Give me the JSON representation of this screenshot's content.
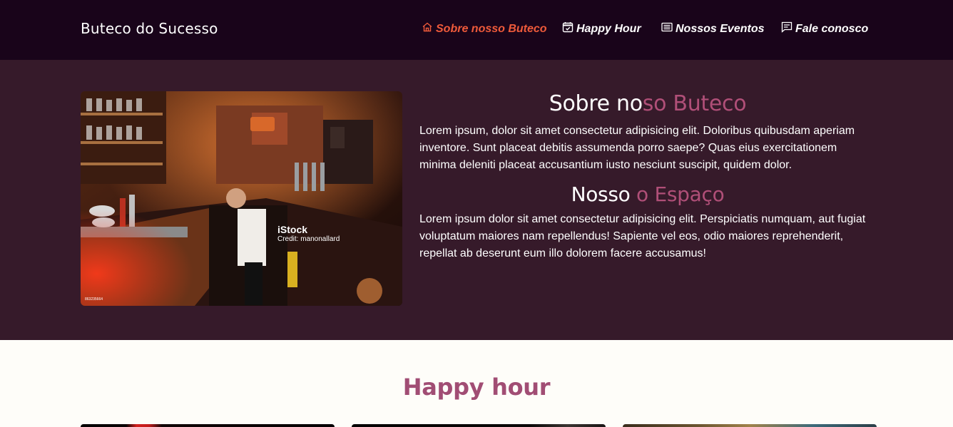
{
  "navbar": {
    "brand": "Buteco do Sucesso",
    "items": [
      {
        "label": "Sobre nosso Buteco",
        "icon": "home-icon",
        "active": true
      },
      {
        "label": "Happy Hour",
        "icon": "calendar-check-icon",
        "active": false
      },
      {
        "label": "Nossos Eventos",
        "icon": "newspaper-icon",
        "active": false
      },
      {
        "label": "Fale conosco",
        "icon": "chat-icon",
        "active": false
      }
    ],
    "colors": {
      "background": "#19041a",
      "active": "#ee5a3a",
      "text": "#ffffff"
    }
  },
  "about": {
    "image": {
      "description": "bar-interior-photo",
      "watermark_brand": "iStock",
      "watermark_credit": "Credit: manonallard",
      "watermark_id": "863235664"
    },
    "heading1_white": "Sobre no",
    "heading1_pink": "so Buteco",
    "paragraph1": "Lorem ipsum, dolor sit amet consectetur adipisicing elit. Doloribus quibusdam aperiam inventore. Sunt placeat debitis assumenda porro saepe? Quas eius exercitationem minima deleniti placeat accusantium iusto nesciunt suscipit, quidem dolor.",
    "heading2_white": "Nosso ",
    "heading2_pink": "o Espaço",
    "paragraph2": "Lorem ipsum dolor sit amet consectetur adipisicing elit. Perspiciatis numquam, aut fugiat voluptatum maiores nam repellendus! Sapiente vel eos, odio maiores reprehenderit, repellat ab deserunt eum illo dolorem facere accusamus!",
    "colors": {
      "background": "#361a2a",
      "accent": "#b04f78"
    }
  },
  "happy_hour": {
    "title": "Happy hour",
    "title_color": "#a14d74",
    "cards": [
      {
        "name": "happy-hour-card-1"
      },
      {
        "name": "happy-hour-card-2"
      },
      {
        "name": "happy-hour-card-3"
      }
    ]
  }
}
